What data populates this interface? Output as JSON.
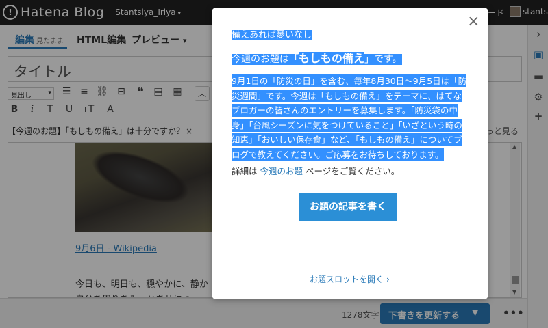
{
  "topbar": {
    "logo_text": "Hatena Blog",
    "blog_user": "Stantsiya_Iriya",
    "right_text": "ード",
    "username": "stantsiya"
  },
  "tabs": {
    "edit": "編集",
    "edit_sub": "見たまま",
    "html": "HTML編集",
    "preview": "プレビュー"
  },
  "editor": {
    "title_placeholder": "タイトル",
    "heading_select": "見出し",
    "topic_text": "【今週のお題】「もしもの備え」は十分ですか？",
    "topic_close": "×",
    "topic_more": "っと見る",
    "link_text": "9月6日 - Wikipedia",
    "para1": "今日も、明日も、穏やかに、静か",
    "para2": "自分を周りをみ　とあせにつ"
  },
  "bottom": {
    "char_count": "1278文字",
    "update_label": "下書きを更新する",
    "more_label": "•••"
  },
  "modal": {
    "line1": "備えあれば憂いなし",
    "line2_pre": "今週のお題は「",
    "line2_topic": "もしもの備え",
    "line2_post": "」です。",
    "para": "9月1日の「防災の日」を含む、毎年8月30日〜9月5日は「防災週間」です。今週は「もしもの備え」をテーマに、はてなブロガーの皆さんのエントリーを募集します。「防災袋の中身」「台風シーズンに気をつけていること」「いざという時の知恵」「おいしい保存食」など、「もしもの備え」についてブログで教えてください。ご応募をお待ちしております。",
    "detail_pre": "詳細は ",
    "detail_link": "今週のお題",
    "detail_post": " ページをご覧ください。",
    "cta_label": "お題の記事を書く",
    "slot_label": "お題スロットを開く ›",
    "close_label": "×"
  },
  "colors": {
    "accent": "#2b7bb9",
    "highlight": "#3390ff",
    "topbar": "#222222"
  }
}
